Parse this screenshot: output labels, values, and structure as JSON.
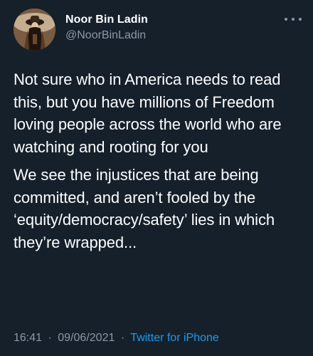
{
  "tweet": {
    "author": {
      "display_name": "Noor Bin Ladin",
      "handle": "@NoorBinLadin"
    },
    "more_icon": "more-dots-icon",
    "paragraphs": [
      "Not sure who in America needs to read this, but you have millions of Freedom loving people across the world who are watching and rooting for you",
      "We see the injustices that are being committed, and aren’t fooled by the ‘equity/democracy/safety’ lies in which they’re wrapped..."
    ],
    "meta": {
      "time": "16:41",
      "date": "09/06/2021",
      "separator": "·",
      "source": "Twitter for iPhone"
    }
  },
  "colors": {
    "background": "#15202b",
    "text": "#ffffff",
    "secondary": "#8b98a5",
    "link": "#1d9bf0"
  }
}
